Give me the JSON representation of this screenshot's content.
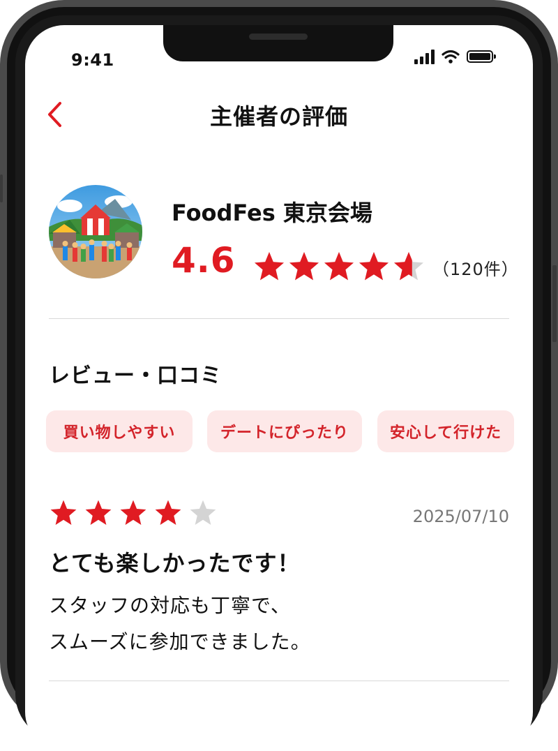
{
  "status_bar": {
    "time": "9:41"
  },
  "header": {
    "title": "主催者の評価"
  },
  "organizer": {
    "name": "FoodFes 東京会場",
    "rating": "4.6",
    "rating_value": 4.6,
    "review_count": "（120件）"
  },
  "reviews_section": {
    "title": "レビュー・口コミ",
    "tags": [
      "買い物しやすい",
      "デートにぴったり",
      "安心して行けた"
    ]
  },
  "review": {
    "stars": 4,
    "date": "2025/07/10",
    "title": "とても楽しかったです！",
    "body_line1": "スタッフの対応も丁寧で、",
    "body_line2": "スムーズに参加できました。"
  },
  "colors": {
    "accent": "#e01b22",
    "tag_bg": "#fde8e8",
    "star_empty": "#d4d4d4"
  },
  "icons": [
    "back-chevron-icon",
    "signal-icon",
    "wifi-icon",
    "battery-icon",
    "star-icon"
  ]
}
